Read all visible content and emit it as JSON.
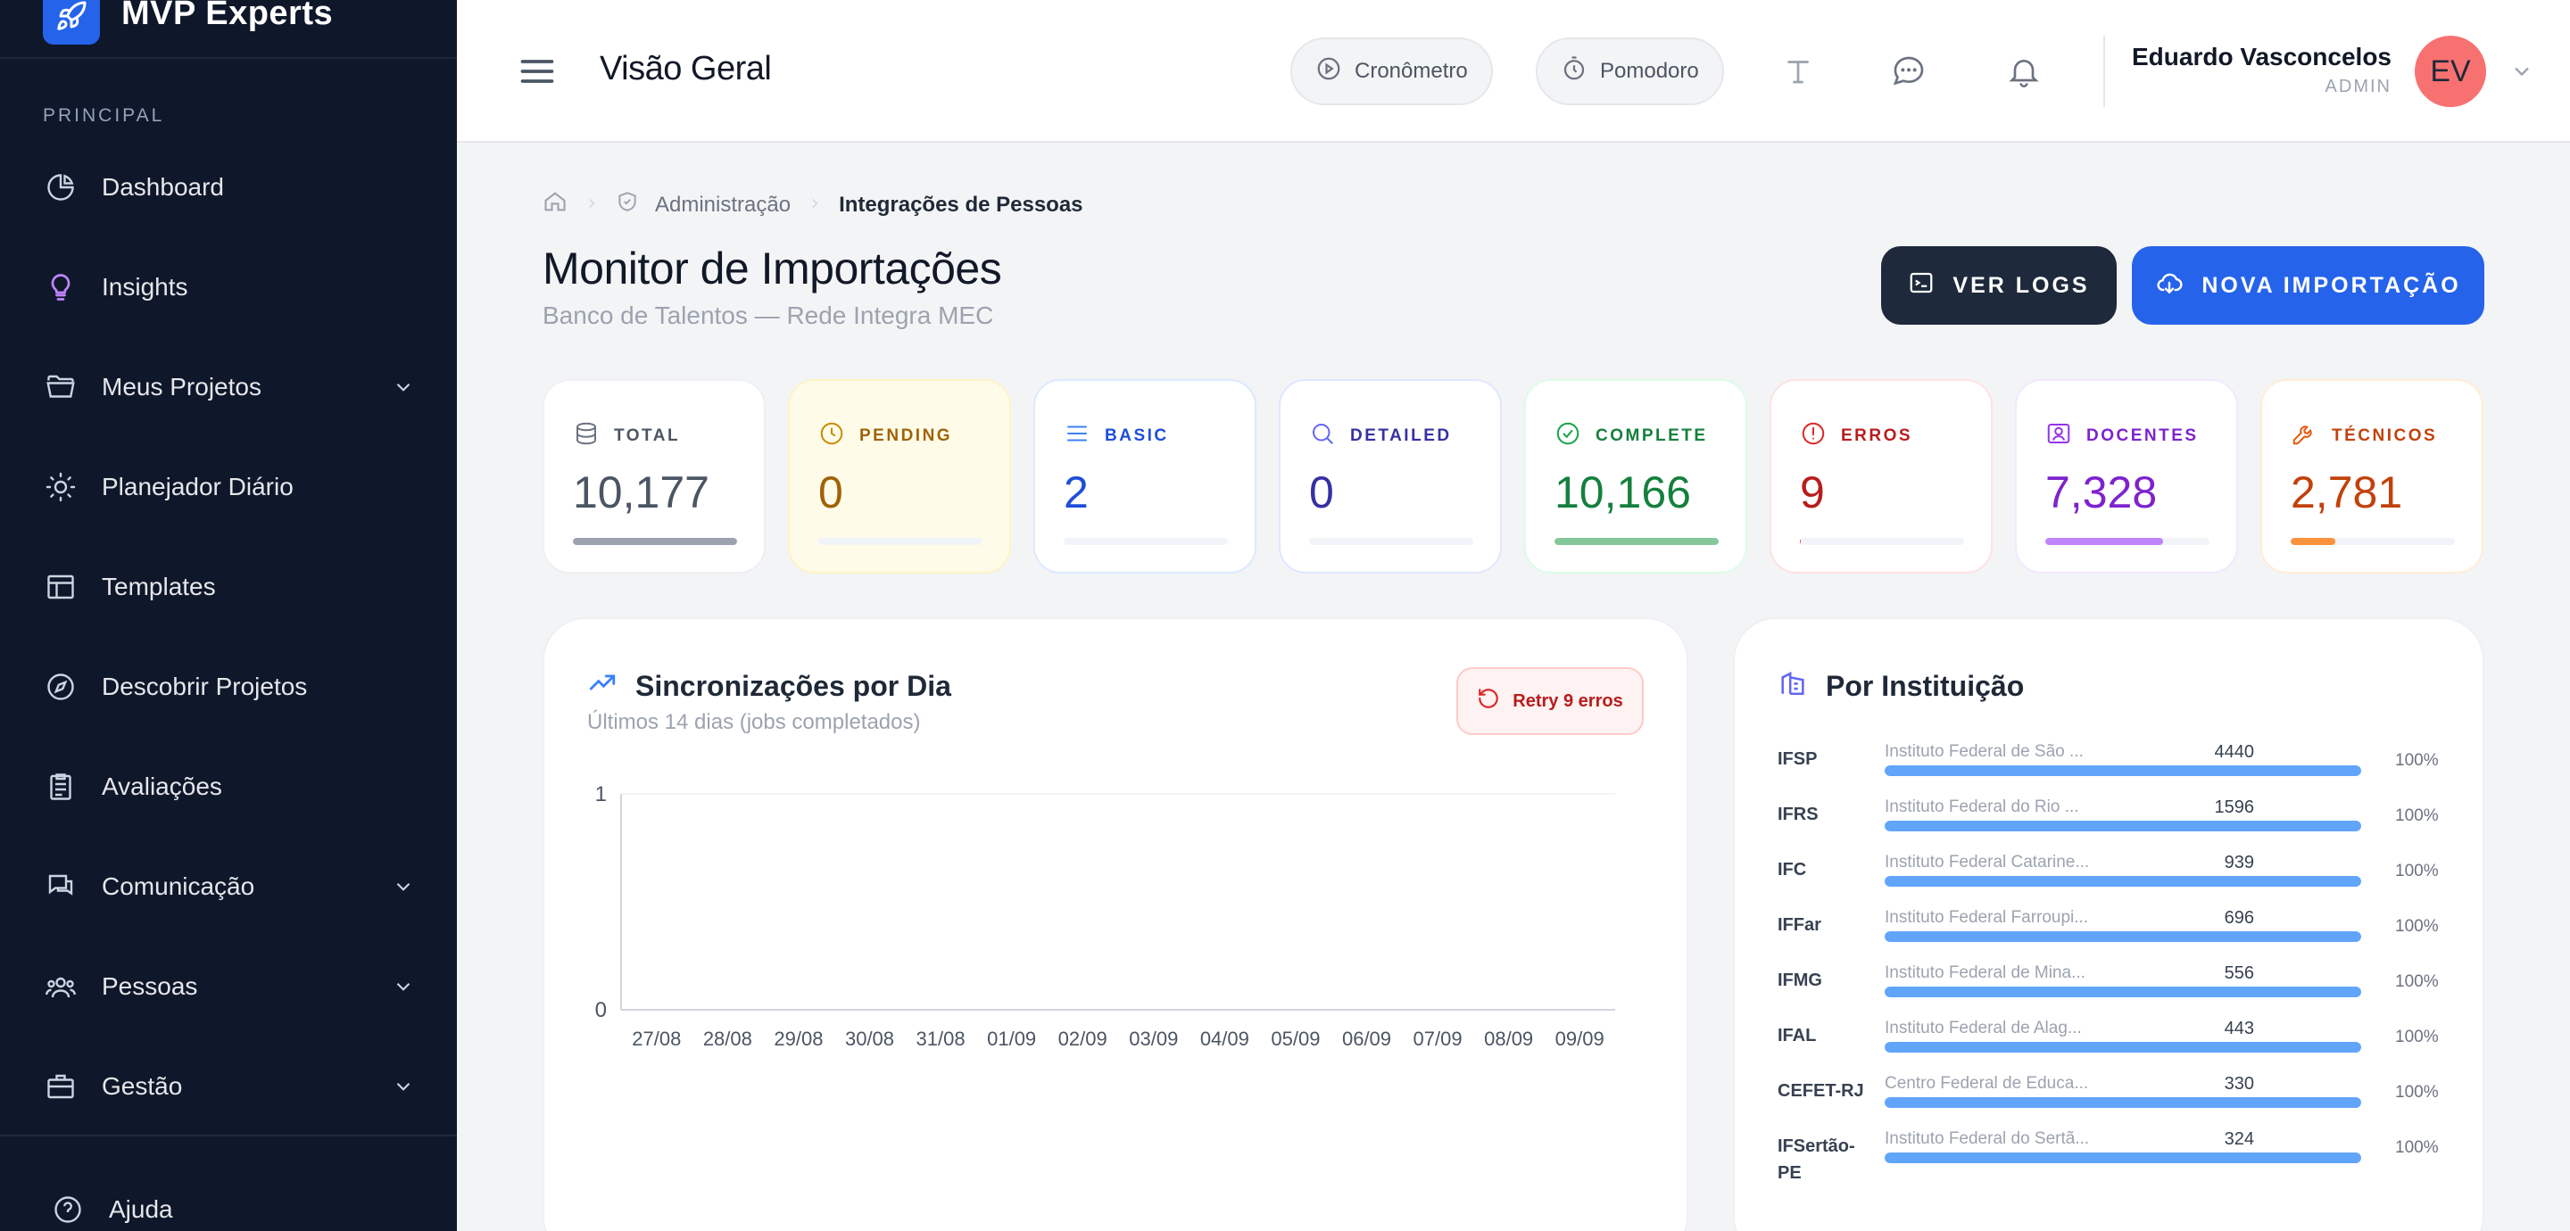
{
  "brand": {
    "name": "MVP Experts"
  },
  "sidebar": {
    "section": "PRINCIPAL",
    "items": [
      {
        "label": "Dashboard",
        "icon": "chart-pie-icon"
      },
      {
        "label": "Insights",
        "icon": "lightbulb-icon"
      },
      {
        "label": "Meus Projetos",
        "icon": "folder-icon",
        "expandable": true
      },
      {
        "label": "Planejador Diário",
        "icon": "sun-icon"
      },
      {
        "label": "Templates",
        "icon": "layout-icon"
      },
      {
        "label": "Descobrir Projetos",
        "icon": "compass-icon"
      },
      {
        "label": "Avaliações",
        "icon": "clipboard-icon"
      },
      {
        "label": "Comunicação",
        "icon": "chat-icon",
        "expandable": true
      },
      {
        "label": "Pessoas",
        "icon": "users-icon",
        "expandable": true
      },
      {
        "label": "Gestão",
        "icon": "briefcase-icon",
        "expandable": true
      }
    ],
    "help": "Ajuda"
  },
  "header": {
    "title": "Visão Geral",
    "timer_label": "Cronômetro",
    "pomodoro_label": "Pomodoro",
    "user": {
      "name": "Eduardo Vasconcelos",
      "role": "ADMIN",
      "initials": "EV"
    }
  },
  "breadcrumb": {
    "parent": "Administração",
    "current": "Integrações de Pessoas"
  },
  "page": {
    "title": "Monitor de Importações",
    "subtitle": "Banco de Talentos — Rede Integra MEC",
    "logs_button": "VER LOGS",
    "new_import_button": "NOVA IMPORTAÇÃO"
  },
  "stats": [
    {
      "label": "TOTAL",
      "value": "10,177",
      "color": "#4b5563",
      "bar_color": "#9ca3af",
      "fill": 1.0,
      "bg": "#ffffff"
    },
    {
      "label": "PENDING",
      "value": "0",
      "color": "#a16207",
      "bar_color": "#facc15",
      "fill": 0,
      "bg": "#fefce8"
    },
    {
      "label": "BASIC",
      "value": "2",
      "color": "#1d4ed8",
      "bar_color": "#3b82f6",
      "fill": 0.0002,
      "bg": "#ffffff"
    },
    {
      "label": "DETAILED",
      "value": "0",
      "color": "#3730a3",
      "bar_color": "#6366f1",
      "fill": 0,
      "bg": "#ffffff"
    },
    {
      "label": "COMPLETE",
      "value": "10,166",
      "color": "#15803d",
      "bar_color": "#86c79a",
      "fill": 0.999,
      "bg": "#ffffff"
    },
    {
      "label": "ERROS",
      "value": "9",
      "color": "#b91c1c",
      "bar_color": "#ef4444",
      "fill": 0.001,
      "bg": "#ffffff"
    },
    {
      "label": "DOCENTES",
      "value": "7,328",
      "color": "#7e22ce",
      "bar_color": "#c084fc",
      "fill": 0.72,
      "bg": "#ffffff"
    },
    {
      "label": "TÉCNICOS",
      "value": "2,781",
      "color": "#c2410c",
      "bar_color": "#fb923c",
      "fill": 0.27,
      "bg": "#ffffff"
    }
  ],
  "sync_chart": {
    "title": "Sincronizações por Dia",
    "subtitle": "Últimos 14 dias (jobs completados)",
    "retry_label": "Retry 9 erros"
  },
  "chart_data": {
    "type": "line",
    "categories": [
      "27/08",
      "28/08",
      "29/08",
      "30/08",
      "31/08",
      "01/09",
      "02/09",
      "03/09",
      "04/09",
      "05/09",
      "06/09",
      "07/09",
      "08/09",
      "09/09"
    ],
    "values": [
      0,
      0,
      0,
      0,
      0,
      0,
      0,
      0,
      0,
      0,
      0,
      0,
      0,
      0
    ],
    "ylim": [
      0,
      1
    ],
    "yticks": [
      "1",
      "0"
    ]
  },
  "institutions": {
    "title": "Por Instituição",
    "rows": [
      {
        "code": "IFSP",
        "name": "Instituto Federal de São ...",
        "count": "4440",
        "pct": "100%",
        "fill": 1.0
      },
      {
        "code": "IFRS",
        "name": "Instituto Federal do Rio ...",
        "count": "1596",
        "pct": "100%",
        "fill": 1.0
      },
      {
        "code": "IFC",
        "name": "Instituto Federal Catarine...",
        "count": "939",
        "pct": "100%",
        "fill": 1.0
      },
      {
        "code": "IFFar",
        "name": "Instituto Federal Farroupi...",
        "count": "696",
        "pct": "100%",
        "fill": 1.0
      },
      {
        "code": "IFMG",
        "name": "Instituto Federal de Mina...",
        "count": "556",
        "pct": "100%",
        "fill": 1.0
      },
      {
        "code": "IFAL",
        "name": "Instituto Federal de Alag...",
        "count": "443",
        "pct": "100%",
        "fill": 1.0
      },
      {
        "code": "CEFET-RJ",
        "name": "Centro Federal de Educa...",
        "count": "330",
        "pct": "100%",
        "fill": 1.0
      },
      {
        "code": "IFSertão-PE",
        "name": "Instituto Federal do Sertã...",
        "count": "324",
        "pct": "100%",
        "fill": 1.0
      }
    ]
  }
}
